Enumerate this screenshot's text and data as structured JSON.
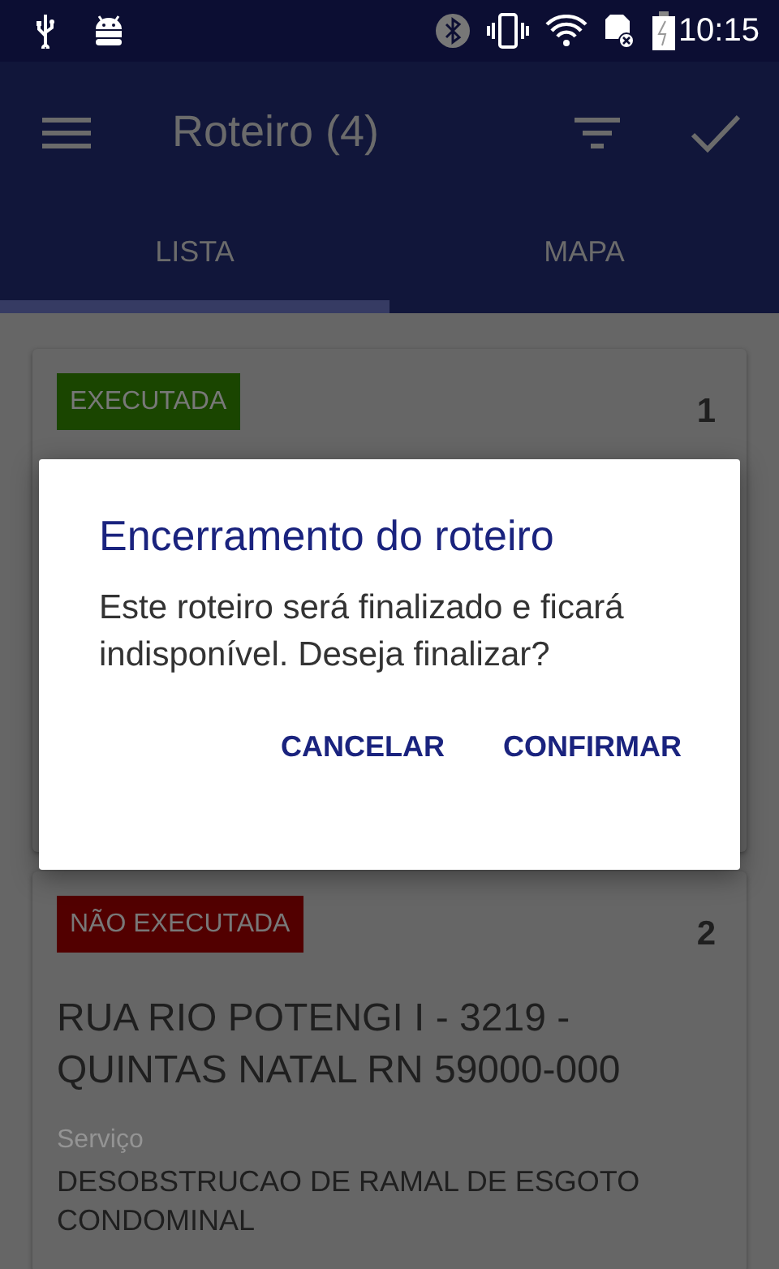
{
  "status_bar": {
    "time": "10:15"
  },
  "toolbar": {
    "title": "Roteiro (4)"
  },
  "tabs": [
    {
      "label": "LISTA",
      "selected": true
    },
    {
      "label": "MAPA",
      "selected": false
    }
  ],
  "cards": [
    {
      "status": "EXECUTADA",
      "color": "#1a4500",
      "number": "1"
    },
    {
      "status": "NÃO EXECUTADA",
      "color": "#520000",
      "number": "2",
      "address": "RUA RIO POTENGI I - 3219 - QUINTAS NATAL RN 59000-000",
      "field_label": "Serviço",
      "field_value": "DESOBSTRUCAO DE RAMAL DE ESGOTO CONDOMINAL"
    }
  ],
  "dialog": {
    "title": "Encerramento do roteiro",
    "message": "Este roteiro será finalizado e ficará indisponível. Deseja finalizar?",
    "buttons": [
      "CANCELAR",
      "CONFIRMAR"
    ]
  }
}
